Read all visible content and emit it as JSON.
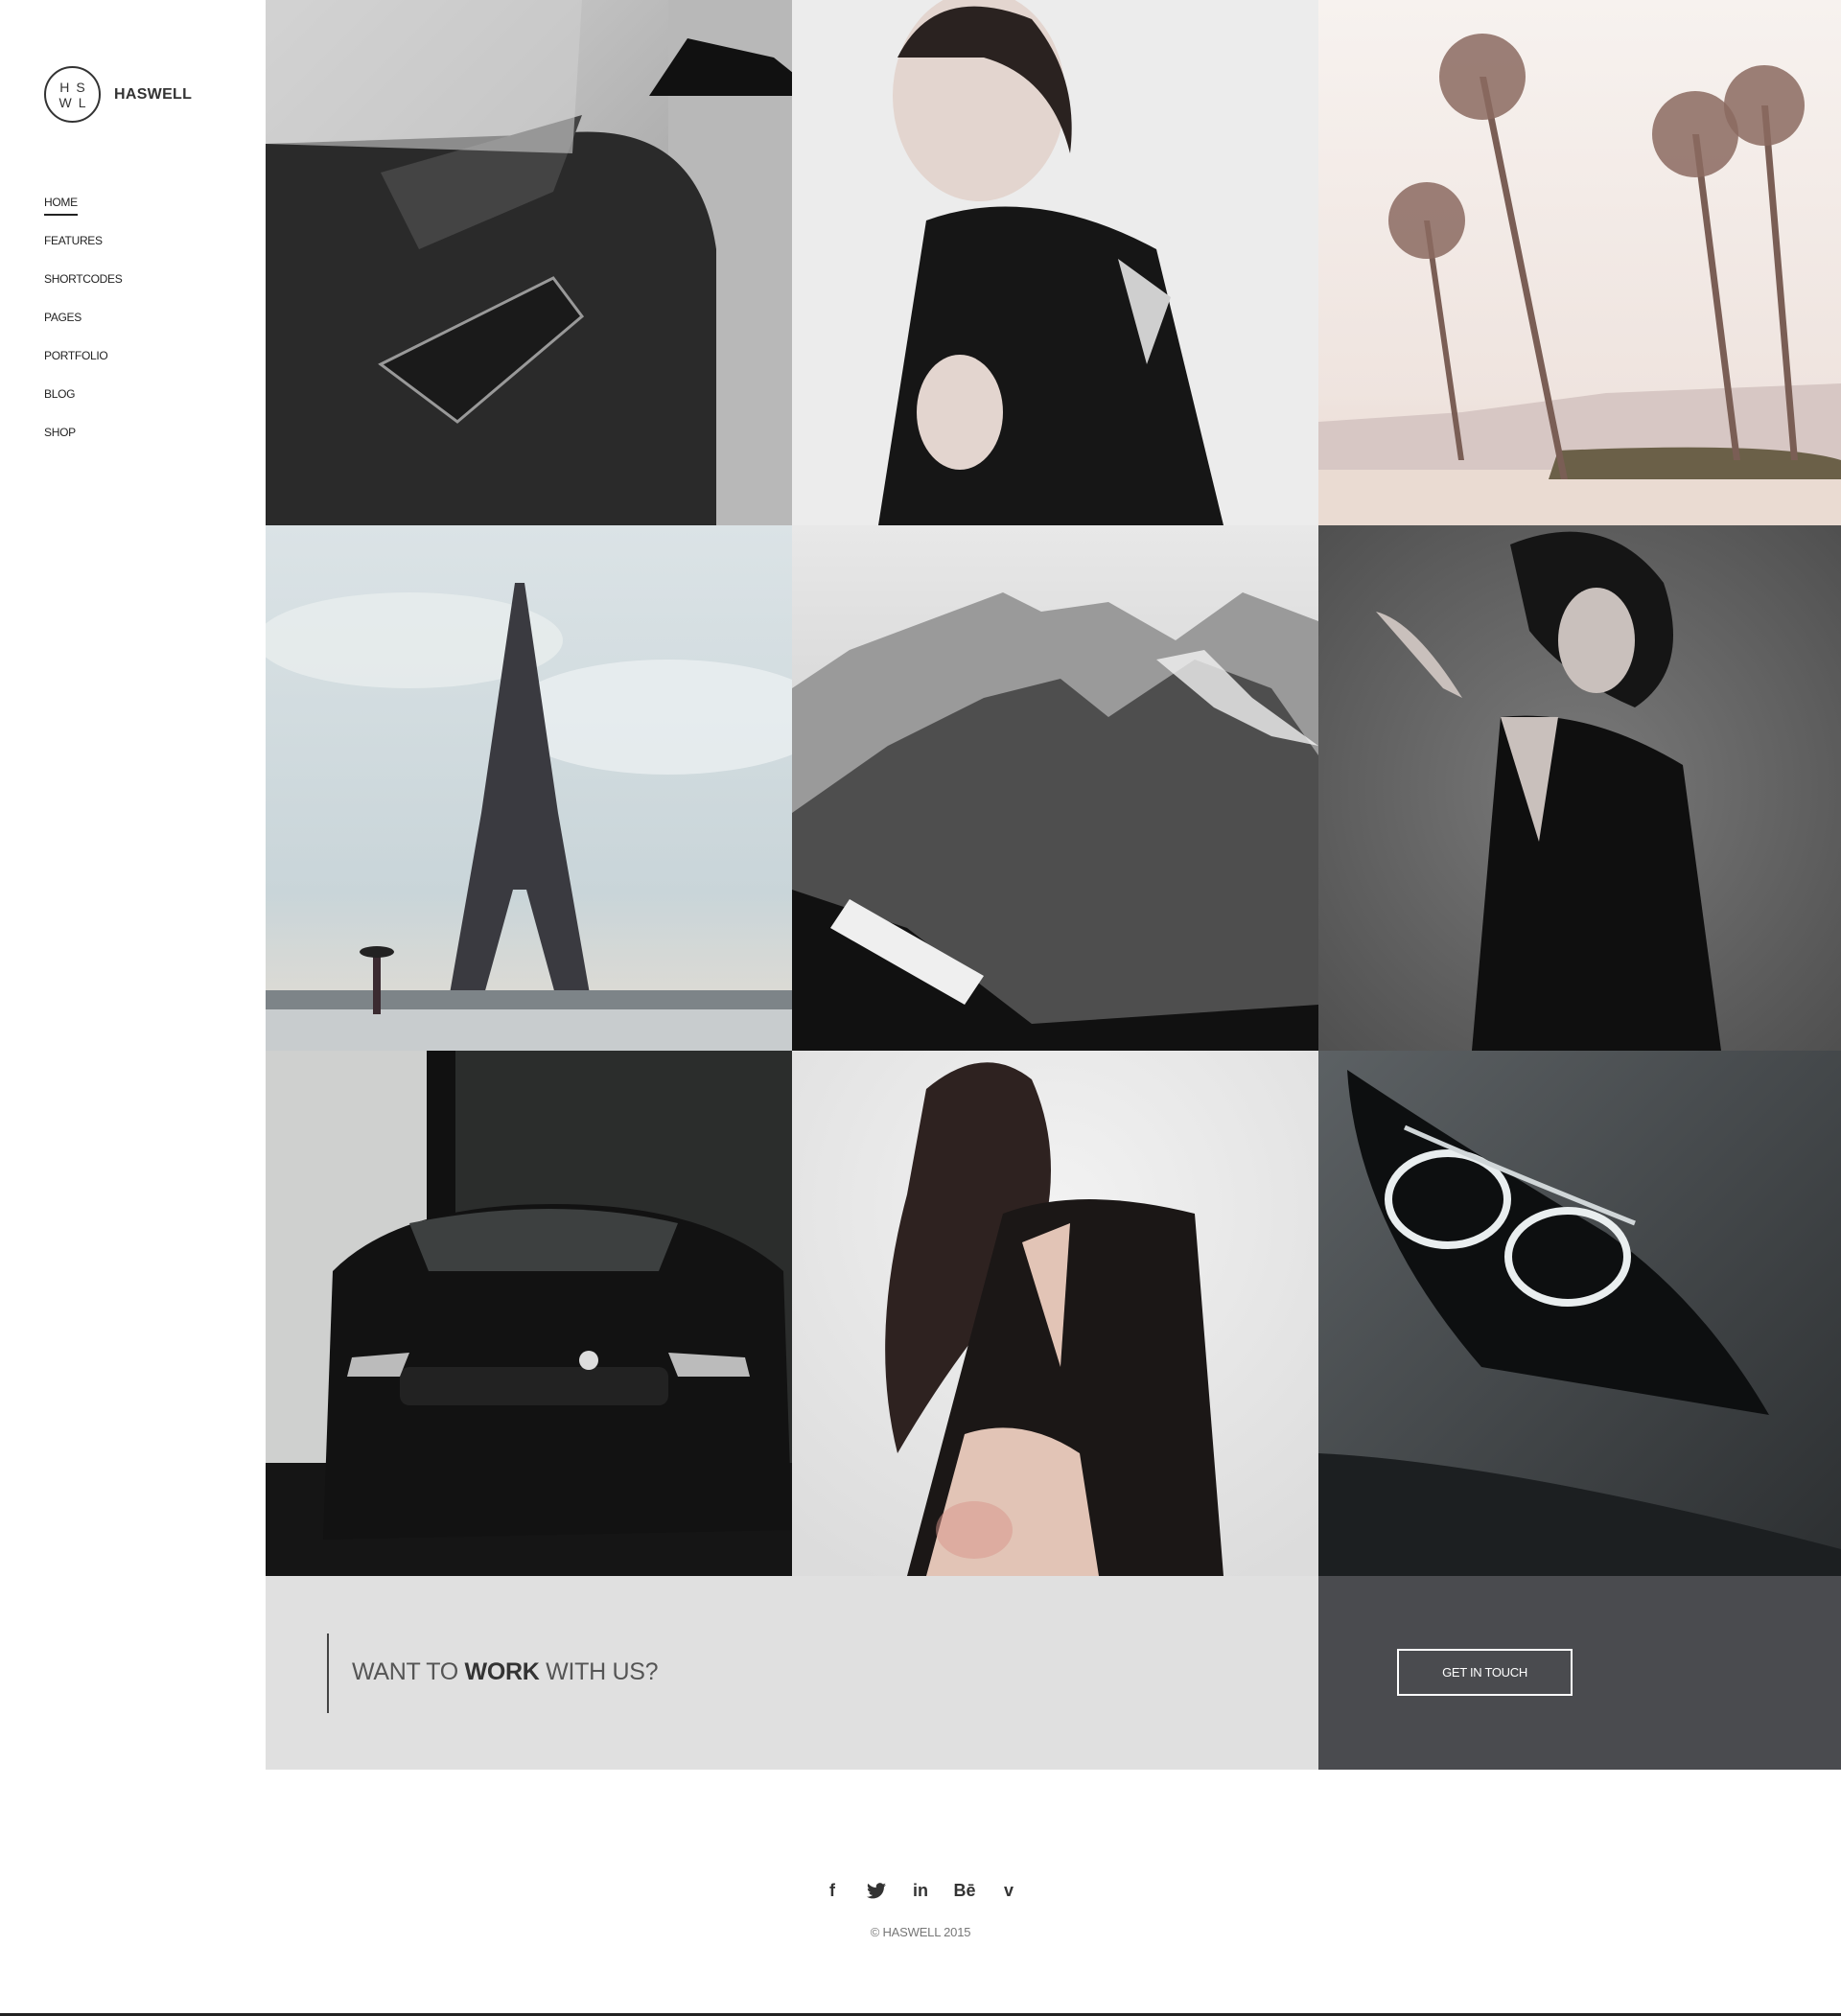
{
  "brand": {
    "logo_letters": [
      "HS",
      "WL"
    ],
    "name": "HASWELL"
  },
  "nav": [
    {
      "label": "HOME",
      "active": true
    },
    {
      "label": "FEATURES"
    },
    {
      "label": "SHORTCODES"
    },
    {
      "label": "PAGES"
    },
    {
      "label": "PORTFOLIO"
    },
    {
      "label": "BLOG"
    },
    {
      "label": "SHOP"
    }
  ],
  "gallery": [
    {
      "subject": "car-side-headlight"
    },
    {
      "subject": "woman-portrait"
    },
    {
      "subject": "palm-trees"
    },
    {
      "subject": "eiffel-tower"
    },
    {
      "subject": "mountains"
    },
    {
      "subject": "woman-black-dress"
    },
    {
      "subject": "black-car-front"
    },
    {
      "subject": "woman-long-hair"
    },
    {
      "subject": "car-headlight-closeup"
    }
  ],
  "cta": {
    "text_before": "WANT TO",
    "text_bold": "WORK",
    "text_after": "WITH US?",
    "button_label": "GET IN TOUCH",
    "colors": {
      "left_bg": "#e0e0e0",
      "right_bg": "#4a4b4f"
    }
  },
  "footer": {
    "social_icons": [
      "facebook-icon",
      "twitter-icon",
      "linkedin-icon",
      "behance-icon",
      "vimeo-icon"
    ],
    "social_glyphs": [
      "f",
      "𝕋",
      "in",
      "Bē",
      "v"
    ],
    "copyright": "© HASWELL 2015"
  }
}
